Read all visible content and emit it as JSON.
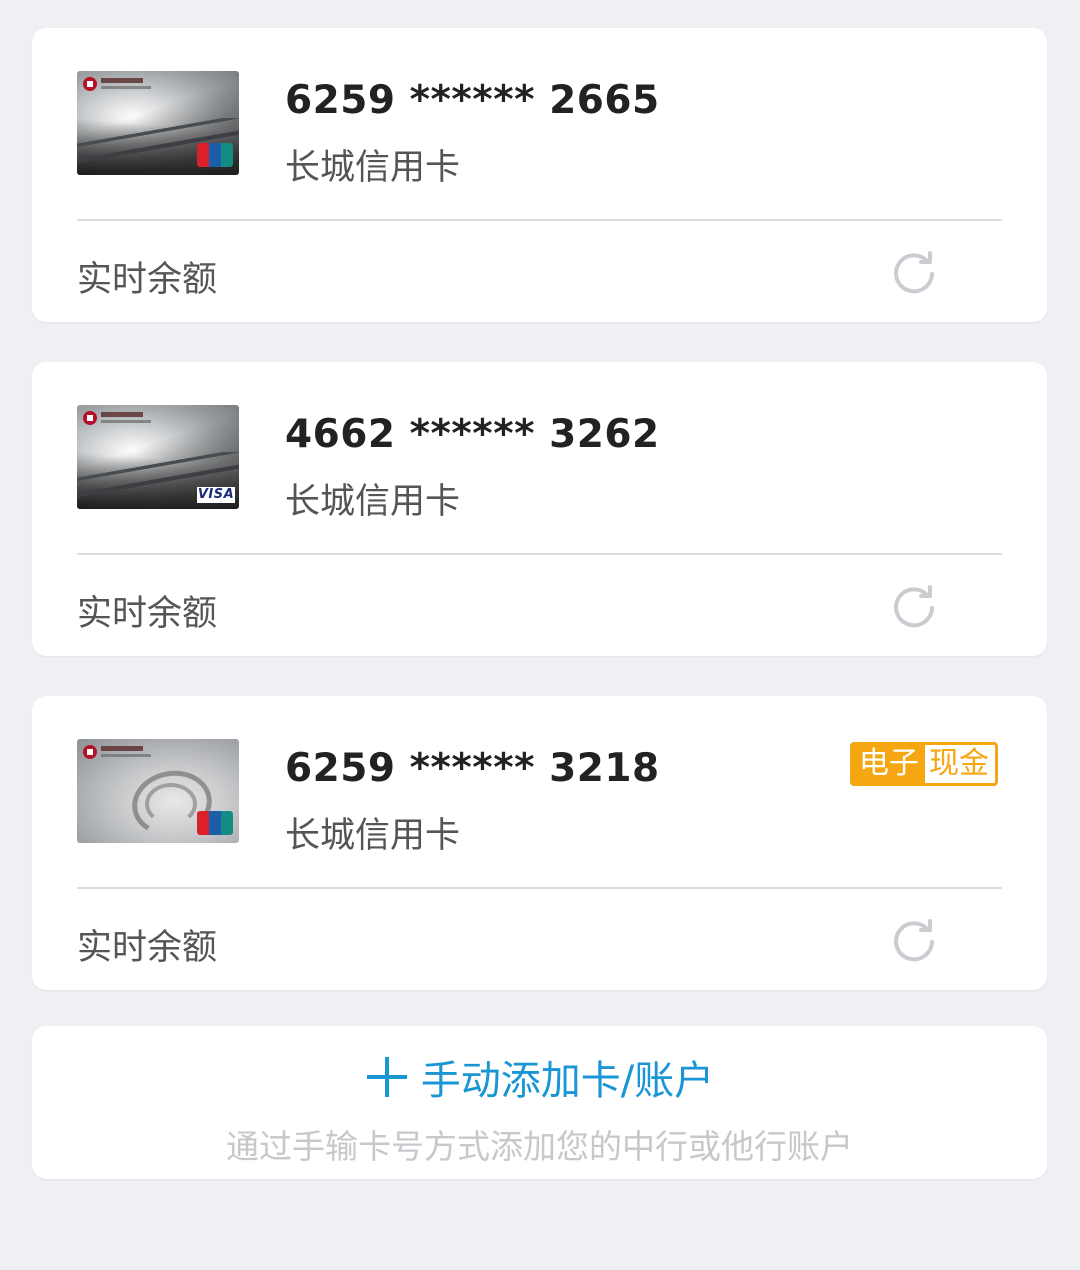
{
  "cards": [
    {
      "number": "6259 ****** 2665",
      "name": "长城信用卡",
      "balance_label": "实时余额",
      "network": "unionpay",
      "thumb_style": "great-wall-silver"
    },
    {
      "number": "4662 ****** 3262",
      "name": "长城信用卡",
      "balance_label": "实时余额",
      "network": "visa",
      "network_label": "VISA",
      "thumb_style": "great-wall-silver"
    },
    {
      "number": "6259 ****** 3218",
      "name": "长城信用卡",
      "balance_label": "实时余额",
      "network": "unionpay",
      "thumb_style": "hainan-silver",
      "badge": {
        "part1": "电子",
        "part2": "现金",
        "color": "#f5a611"
      }
    }
  ],
  "add_card": {
    "label": "手动添加卡/账户",
    "hint": "通过手输卡号方式添加您的中行或他行账户",
    "icon": "plus-icon",
    "color": "#1a96d4"
  },
  "icons": {
    "refresh": "refresh-icon"
  }
}
